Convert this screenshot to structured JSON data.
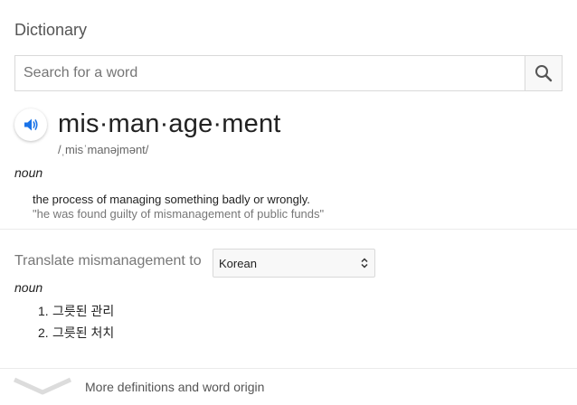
{
  "header": {
    "title": "Dictionary"
  },
  "search": {
    "placeholder": "Search for a word",
    "value": ""
  },
  "entry": {
    "word": "mis·man·age·ment",
    "phonetic": "/ˌmisˈmanəjmənt/",
    "part_of_speech": "noun",
    "definition": "the process of managing something badly or wrongly.",
    "example": "\"he was found guilty of mismanagement of public funds\""
  },
  "translate": {
    "label": "Translate mismanagement to",
    "selected_language": "Korean",
    "part_of_speech": "noun",
    "items": [
      {
        "num": "1.",
        "text": "그릇된 관리"
      },
      {
        "num": "2.",
        "text": "그릇된 처치"
      }
    ]
  },
  "footer": {
    "more_label": "More definitions and word origin"
  },
  "colors": {
    "icon_blue": "#1a73e8",
    "icon_gray": "#555555"
  }
}
